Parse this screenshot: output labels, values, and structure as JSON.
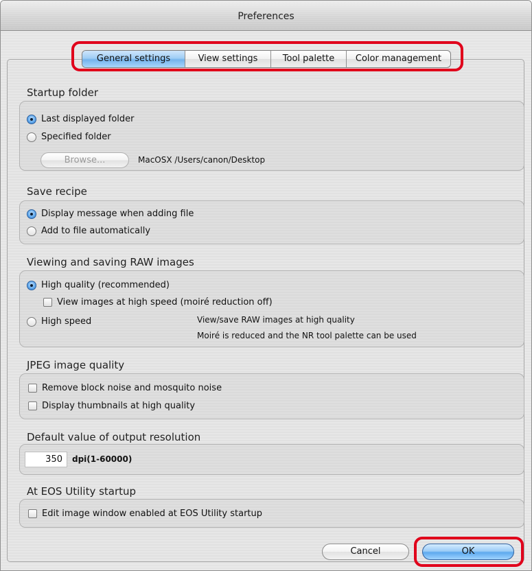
{
  "window": {
    "title": "Preferences"
  },
  "tabs": [
    {
      "label": "General settings",
      "active": true
    },
    {
      "label": "View settings",
      "active": false
    },
    {
      "label": "Tool palette",
      "active": false
    },
    {
      "label": "Color management",
      "active": false
    }
  ],
  "startup_folder": {
    "title": "Startup folder",
    "options": [
      {
        "label": "Last displayed folder",
        "selected": true
      },
      {
        "label": "Specified folder",
        "selected": false
      }
    ],
    "browse_label": "Browse...",
    "path": "MacOSX /Users/canon/Desktop"
  },
  "save_recipe": {
    "title": "Save recipe",
    "options": [
      {
        "label": "Display message when adding file",
        "selected": true
      },
      {
        "label": "Add to file automatically",
        "selected": false
      }
    ]
  },
  "raw": {
    "title": "Viewing and saving RAW images",
    "high_quality": {
      "label": "High quality (recommended)",
      "selected": true
    },
    "high_speed_view": {
      "label": "View images at high speed (moiré reduction off)",
      "checked": false
    },
    "high_speed": {
      "label": "High speed",
      "selected": false
    },
    "description": [
      "View/save RAW images at high quality",
      "Moiré is reduced and the NR tool palette can be used"
    ]
  },
  "jpeg": {
    "title": "JPEG image quality",
    "options": [
      {
        "label": "Remove block noise and mosquito noise",
        "checked": false
      },
      {
        "label": "Display thumbnails at high quality",
        "checked": false
      }
    ]
  },
  "resolution": {
    "title": "Default value of output resolution",
    "value": "350",
    "unit": "dpi(1-60000)"
  },
  "eos": {
    "title": "At EOS Utility startup",
    "option": {
      "label": "Edit image window enabled at EOS Utility startup",
      "checked": false
    }
  },
  "buttons": {
    "cancel": "Cancel",
    "ok": "OK"
  },
  "colors": {
    "highlight": "#e0001b",
    "accent": "#5ea9ee"
  }
}
